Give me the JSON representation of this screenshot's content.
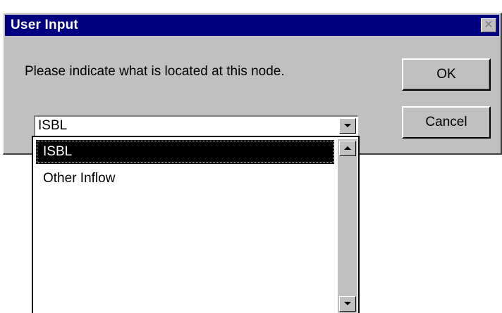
{
  "dialog": {
    "title": "User Input",
    "close_symbol": "✕",
    "prompt": "Please indicate what is located at this node.",
    "ok_label": "OK",
    "cancel_label": "Cancel"
  },
  "combo": {
    "selected_value": "ISBL",
    "options": [
      "ISBL",
      "Other Inflow"
    ]
  },
  "icons": {
    "close": "close-icon",
    "dropdown": "chevron-down-icon",
    "scroll_up": "scroll-up-arrow-icon",
    "scroll_down": "scroll-down-arrow-icon"
  },
  "colors": {
    "titlebar": "#000080",
    "dialog_face": "#c0c0c0",
    "selection": "#000000"
  }
}
